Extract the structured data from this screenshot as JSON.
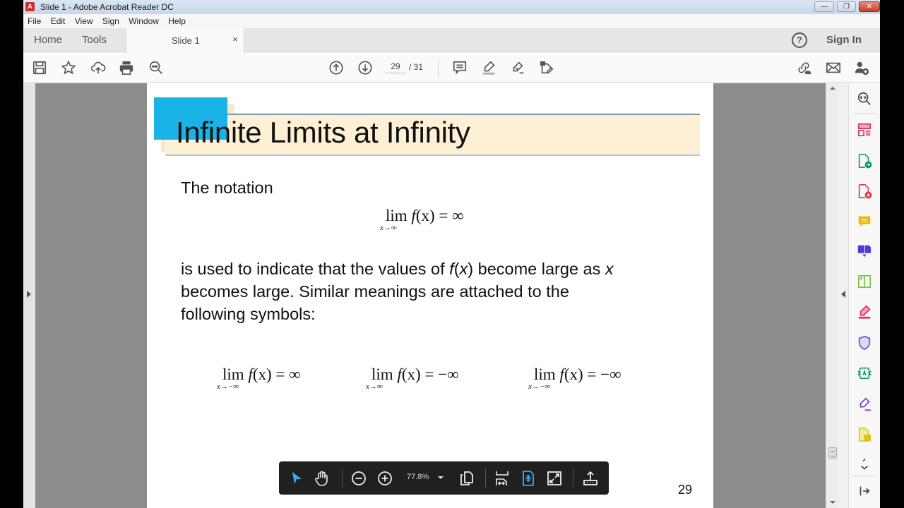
{
  "window": {
    "title": "Slide 1 - Adobe Acrobat Reader DC",
    "app_icon": "acrobat-icon",
    "controls": [
      "minimize",
      "restore",
      "close"
    ]
  },
  "menu": {
    "items": [
      {
        "label": "File"
      },
      {
        "label": "Edit"
      },
      {
        "label": "View"
      },
      {
        "label": "Sign"
      },
      {
        "label": "Window"
      },
      {
        "label": "Help"
      }
    ]
  },
  "tabs": {
    "home": "Home",
    "tools": "Tools",
    "document": "Slide 1",
    "close_glyph": "×",
    "help_glyph": "?",
    "sign_in": "Sign In"
  },
  "toolbar": {
    "left_icons": [
      "save-icon",
      "bookmark-star-icon",
      "upload-cloud-icon",
      "print-icon",
      "find-zoom-icon"
    ],
    "page_current": "29",
    "page_total": "/ 31",
    "nav_icons": [
      "page-up-icon",
      "page-down-icon"
    ],
    "tool_icons": [
      "comment-icon",
      "highlight-pen-icon",
      "fill-sign-icon",
      "edit-share-icon"
    ],
    "right_icons": [
      "share-link-icon",
      "email-icon",
      "add-user-icon"
    ]
  },
  "right_pane": {
    "icons": [
      {
        "name": "zoom-search-icon",
        "color": "#444444"
      },
      {
        "name": "organize-pages-icon",
        "color": "#d4336b"
      },
      {
        "name": "export-pdf-icon",
        "color": "#1a9a6b"
      },
      {
        "name": "create-pdf-icon",
        "color": "#d93a4a"
      },
      {
        "name": "comment-tool-icon",
        "color": "#e6b818"
      },
      {
        "name": "combine-files-icon",
        "color": "#4a3fd1"
      },
      {
        "name": "compress-pdf-icon",
        "color": "#7ac143"
      },
      {
        "name": "fill-sign-tool-icon",
        "color": "#e62e6b"
      },
      {
        "name": "protect-icon",
        "color": "#5b4fd6"
      },
      {
        "name": "send-review-icon",
        "color": "#1a9a6b"
      },
      {
        "name": "request-signature-icon",
        "color": "#6a3fc8"
      },
      {
        "name": "send-track-icon",
        "color": "#d9c21a"
      },
      {
        "name": "more-tools-icon",
        "color": "#444444"
      },
      {
        "name": "collapse-pane-icon",
        "color": "#444444"
      }
    ]
  },
  "slide": {
    "title": "Infinite Limits at Infinity",
    "intro": "The notation",
    "main_formula": {
      "lim": "lim",
      "sub": "x→∞",
      "expr_f": "f",
      "expr_rest": "(x) = ∞"
    },
    "paragraph": {
      "line1_pre": "is used to indicate that the values of ",
      "line1_f": "f",
      "line1_mid": "(",
      "line1_x": "x",
      "line1_post": ") become large as ",
      "line1_x2": "x",
      "line2": "becomes large. Similar meanings are attached to the",
      "line3": "following symbols:"
    },
    "formulas": [
      {
        "lim": "lim",
        "sub": "x→−∞",
        "expr_f": "f",
        "expr_rest": "(x) = ∞"
      },
      {
        "lim": "lim",
        "sub": "x→∞",
        "expr_f": "f",
        "expr_rest": "(x) = −∞"
      },
      {
        "lim": "lim",
        "sub": "x→−∞",
        "expr_f": "f",
        "expr_rest": "(x) = −∞"
      }
    ],
    "page_number": "29",
    "accent_color": "#1ab3e6",
    "band_color": "#fdf0d5"
  },
  "floating_toolbar": {
    "zoom_value": "77.8%",
    "icons": [
      "select-arrow-icon",
      "hand-pan-icon",
      "zoom-out-icon",
      "zoom-in-icon",
      "zoom-dropdown-icon",
      "page-view-icon",
      "fit-page-icon",
      "fit-width-icon",
      "fullscreen-icon",
      "share-upload-icon"
    ]
  }
}
